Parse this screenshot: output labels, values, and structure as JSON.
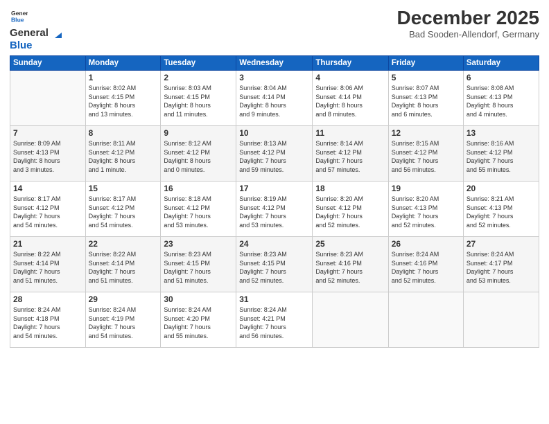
{
  "header": {
    "logo_general": "General",
    "logo_blue": "Blue",
    "month_title": "December 2025",
    "location": "Bad Sooden-Allendorf, Germany"
  },
  "weekdays": [
    "Sunday",
    "Monday",
    "Tuesday",
    "Wednesday",
    "Thursday",
    "Friday",
    "Saturday"
  ],
  "weeks": [
    [
      {
        "day": "",
        "info": ""
      },
      {
        "day": "1",
        "info": "Sunrise: 8:02 AM\nSunset: 4:15 PM\nDaylight: 8 hours\nand 13 minutes."
      },
      {
        "day": "2",
        "info": "Sunrise: 8:03 AM\nSunset: 4:15 PM\nDaylight: 8 hours\nand 11 minutes."
      },
      {
        "day": "3",
        "info": "Sunrise: 8:04 AM\nSunset: 4:14 PM\nDaylight: 8 hours\nand 9 minutes."
      },
      {
        "day": "4",
        "info": "Sunrise: 8:06 AM\nSunset: 4:14 PM\nDaylight: 8 hours\nand 8 minutes."
      },
      {
        "day": "5",
        "info": "Sunrise: 8:07 AM\nSunset: 4:13 PM\nDaylight: 8 hours\nand 6 minutes."
      },
      {
        "day": "6",
        "info": "Sunrise: 8:08 AM\nSunset: 4:13 PM\nDaylight: 8 hours\nand 4 minutes."
      }
    ],
    [
      {
        "day": "7",
        "info": "Sunrise: 8:09 AM\nSunset: 4:13 PM\nDaylight: 8 hours\nand 3 minutes."
      },
      {
        "day": "8",
        "info": "Sunrise: 8:11 AM\nSunset: 4:12 PM\nDaylight: 8 hours\nand 1 minute."
      },
      {
        "day": "9",
        "info": "Sunrise: 8:12 AM\nSunset: 4:12 PM\nDaylight: 8 hours\nand 0 minutes."
      },
      {
        "day": "10",
        "info": "Sunrise: 8:13 AM\nSunset: 4:12 PM\nDaylight: 7 hours\nand 59 minutes."
      },
      {
        "day": "11",
        "info": "Sunrise: 8:14 AM\nSunset: 4:12 PM\nDaylight: 7 hours\nand 57 minutes."
      },
      {
        "day": "12",
        "info": "Sunrise: 8:15 AM\nSunset: 4:12 PM\nDaylight: 7 hours\nand 56 minutes."
      },
      {
        "day": "13",
        "info": "Sunrise: 8:16 AM\nSunset: 4:12 PM\nDaylight: 7 hours\nand 55 minutes."
      }
    ],
    [
      {
        "day": "14",
        "info": "Sunrise: 8:17 AM\nSunset: 4:12 PM\nDaylight: 7 hours\nand 54 minutes."
      },
      {
        "day": "15",
        "info": "Sunrise: 8:17 AM\nSunset: 4:12 PM\nDaylight: 7 hours\nand 54 minutes."
      },
      {
        "day": "16",
        "info": "Sunrise: 8:18 AM\nSunset: 4:12 PM\nDaylight: 7 hours\nand 53 minutes."
      },
      {
        "day": "17",
        "info": "Sunrise: 8:19 AM\nSunset: 4:12 PM\nDaylight: 7 hours\nand 53 minutes."
      },
      {
        "day": "18",
        "info": "Sunrise: 8:20 AM\nSunset: 4:12 PM\nDaylight: 7 hours\nand 52 minutes."
      },
      {
        "day": "19",
        "info": "Sunrise: 8:20 AM\nSunset: 4:13 PM\nDaylight: 7 hours\nand 52 minutes."
      },
      {
        "day": "20",
        "info": "Sunrise: 8:21 AM\nSunset: 4:13 PM\nDaylight: 7 hours\nand 52 minutes."
      }
    ],
    [
      {
        "day": "21",
        "info": "Sunrise: 8:22 AM\nSunset: 4:14 PM\nDaylight: 7 hours\nand 51 minutes."
      },
      {
        "day": "22",
        "info": "Sunrise: 8:22 AM\nSunset: 4:14 PM\nDaylight: 7 hours\nand 51 minutes."
      },
      {
        "day": "23",
        "info": "Sunrise: 8:23 AM\nSunset: 4:15 PM\nDaylight: 7 hours\nand 51 minutes."
      },
      {
        "day": "24",
        "info": "Sunrise: 8:23 AM\nSunset: 4:15 PM\nDaylight: 7 hours\nand 52 minutes."
      },
      {
        "day": "25",
        "info": "Sunrise: 8:23 AM\nSunset: 4:16 PM\nDaylight: 7 hours\nand 52 minutes."
      },
      {
        "day": "26",
        "info": "Sunrise: 8:24 AM\nSunset: 4:16 PM\nDaylight: 7 hours\nand 52 minutes."
      },
      {
        "day": "27",
        "info": "Sunrise: 8:24 AM\nSunset: 4:17 PM\nDaylight: 7 hours\nand 53 minutes."
      }
    ],
    [
      {
        "day": "28",
        "info": "Sunrise: 8:24 AM\nSunset: 4:18 PM\nDaylight: 7 hours\nand 54 minutes."
      },
      {
        "day": "29",
        "info": "Sunrise: 8:24 AM\nSunset: 4:19 PM\nDaylight: 7 hours\nand 54 minutes."
      },
      {
        "day": "30",
        "info": "Sunrise: 8:24 AM\nSunset: 4:20 PM\nDaylight: 7 hours\nand 55 minutes."
      },
      {
        "day": "31",
        "info": "Sunrise: 8:24 AM\nSunset: 4:21 PM\nDaylight: 7 hours\nand 56 minutes."
      },
      {
        "day": "",
        "info": ""
      },
      {
        "day": "",
        "info": ""
      },
      {
        "day": "",
        "info": ""
      }
    ]
  ]
}
